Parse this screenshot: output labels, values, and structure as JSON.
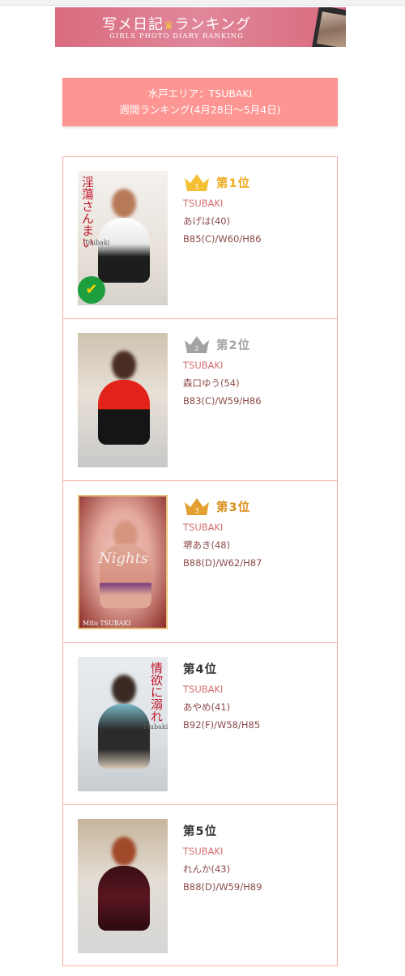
{
  "banner": {
    "title_a": "写メ日記",
    "title_b": "ランキング",
    "subtitle": "GIRLS PHOTO DIARY RANKING"
  },
  "area": {
    "line1": "水戸エリア：TSUBAKI",
    "line2": "週間ランキング(4月28日〜5月4日)"
  },
  "colors": {
    "gold": "#f0a81c",
    "silver": "#a3a3a3",
    "bronze": "#d98e1a",
    "accent": "#fd9592",
    "shop_text": "#d46e6e",
    "detail_text": "#8d4b4b"
  },
  "entries": [
    {
      "rank": "第1位",
      "crown": "gold",
      "crown_num": "1",
      "shop": "TSUBAKI",
      "name": "あげは(40)",
      "size": "B85(C)/W60/H86",
      "photo_text": "淫蕩さんまい",
      "photo_caption": "Tsubaki"
    },
    {
      "rank": "第2位",
      "crown": "silver",
      "crown_num": "2",
      "shop": "TSUBAKI",
      "name": "森口ゆう(54)",
      "size": "B83(C)/W59/H86"
    },
    {
      "rank": "第3位",
      "crown": "bronze",
      "crown_num": "3",
      "shop": "TSUBAKI",
      "name": "堺あき(48)",
      "size": "B88(D)/W62/H87",
      "photo_logo": "Nights",
      "photo_caption": "Mito TSUBAKI"
    },
    {
      "rank": "第4位",
      "shop": "TSUBAKI",
      "name": "あやめ(41)",
      "size": "B92(F)/W58/H85",
      "photo_text": "情欲に溺れ",
      "photo_caption": "Tsubaki"
    },
    {
      "rank": "第5位",
      "shop": "TSUBAKI",
      "name": "れんか(43)",
      "size": "B88(D)/W59/H89"
    }
  ]
}
